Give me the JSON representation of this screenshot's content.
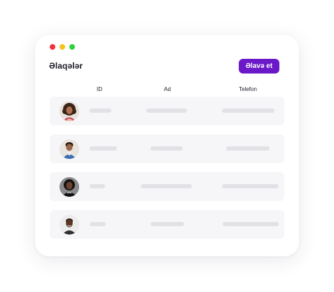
{
  "window": {
    "title": "Əlaqələr",
    "add_button_label": "Əlavə et",
    "accent_color": "#6b19c8"
  },
  "table": {
    "columns": [
      "ID",
      "Ad",
      "Telefon"
    ],
    "rows": [
      {
        "avatar": "avatar-woman-curly-hair"
      },
      {
        "avatar": "avatar-man-casual-shirt"
      },
      {
        "avatar": "avatar-woman-black-top"
      },
      {
        "avatar": "avatar-man-smiling"
      }
    ],
    "placeholder_color": "#e2e2e6",
    "row_background": "#f6f6f8"
  },
  "window_controls": {
    "close_color": "#f2313a",
    "minimize_color": "#f6c21a",
    "maximize_color": "#2fd13b"
  }
}
